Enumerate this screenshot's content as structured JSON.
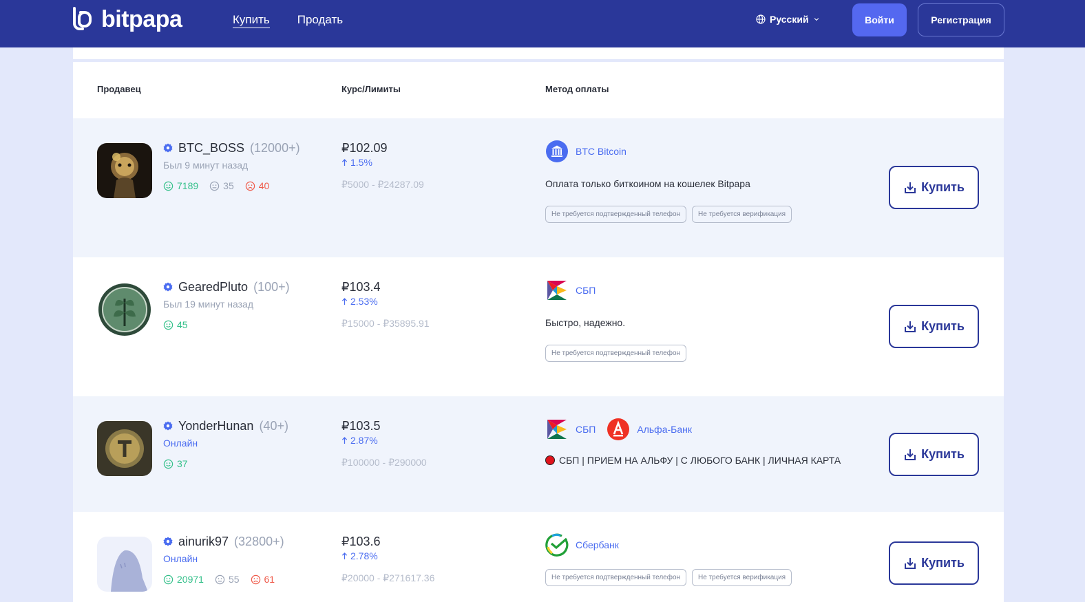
{
  "header": {
    "logo_text": "bitpapa",
    "nav": [
      {
        "label": "Купить",
        "active": true
      },
      {
        "label": "Продать",
        "active": false
      }
    ],
    "language": "Русский",
    "login_label": "Войти",
    "register_label": "Регистрация"
  },
  "table": {
    "col_seller": "Продавец",
    "col_rate": "Курс/Лимиты",
    "col_payment": "Метод оплаты"
  },
  "buy_label": "Купить",
  "offers": [
    {
      "name": "BTC_BOSS",
      "count": "(12000+)",
      "status": "Был 9 минут назад",
      "reviews_good": "7189",
      "reviews_neutral": "35",
      "reviews_bad": "40",
      "rate": "₽102.09",
      "change": "1.5%",
      "limits": "₽5000 - ₽24287.09",
      "methods": [
        {
          "name": "BTC Bitcoin",
          "icon": "bank-icon"
        }
      ],
      "description": "Оплата только биткоином на кошелек Bitpapa",
      "tags": [
        "Не требуется подтвержденный телефон",
        "Не требуется верификация"
      ]
    },
    {
      "name": "GearedPluto",
      "count": "(100+)",
      "status": "Был 19 минут назад",
      "reviews_good": "45",
      "rate": "₽103.4",
      "change": "2.53%",
      "limits": "₽15000 - ₽35895.91",
      "methods": [
        {
          "name": "СБП",
          "icon": "sbp-icon"
        }
      ],
      "description": "Быстро, надежно.",
      "tags": [
        "Не требуется подтвержденный телефон"
      ]
    },
    {
      "name": "YonderHunan",
      "count": "(40+)",
      "status": "Онлайн",
      "reviews_good": "37",
      "rate": "₽103.5",
      "change": "2.87%",
      "limits": "₽100000 - ₽290000",
      "methods": [
        {
          "name": "СБП",
          "icon": "sbp-icon"
        },
        {
          "name": "Альфа-Банк",
          "icon": "alfa-bank-icon"
        }
      ],
      "description": "СБП | ПРИЕМ НА АЛЬФУ | С ЛЮБОГО БАНК | ЛИЧНАЯ КАРТА"
    },
    {
      "name": "ainurik97",
      "count": "(32800+)",
      "status": "Онлайн",
      "reviews_good": "20971",
      "reviews_neutral": "55",
      "reviews_bad": "61",
      "rate": "₽103.6",
      "change": "2.78%",
      "limits": "₽20000 - ₽271617.36",
      "methods": [
        {
          "name": "Сбербанк",
          "icon": "sberbank-icon"
        }
      ],
      "tags": [
        "Не требуется подтвержденный телефон",
        "Не требуется верификация"
      ]
    }
  ],
  "colors": {
    "header_bg": "#2a3799",
    "accent": "#4a6cf0",
    "good": "#34c08a",
    "bad": "#ef5a4a"
  }
}
